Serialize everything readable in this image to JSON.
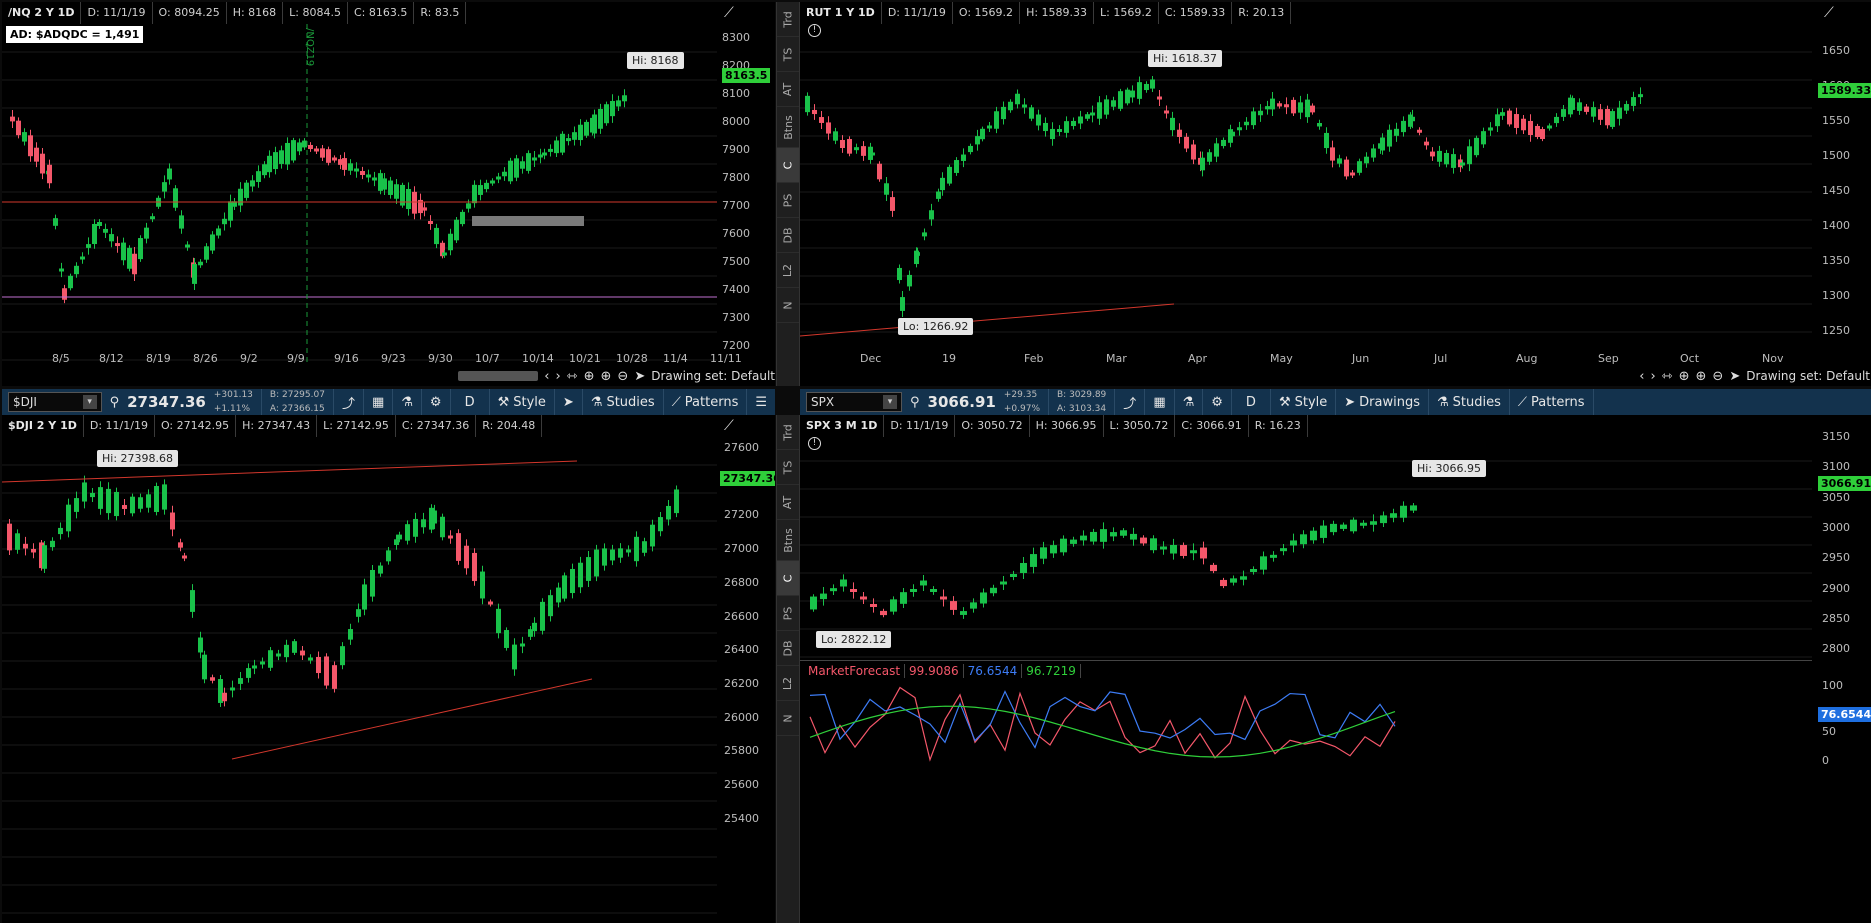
{
  "colors": {
    "up": "#19c24a",
    "down": "#f4576a",
    "accent": "#13324d",
    "pricetag": "#2fcf3a",
    "line_red": "#d2372c",
    "line_purple": "#c070d0"
  },
  "panels": {
    "nq": {
      "header": [
        "/NQ 2 Y 1D",
        "D: 11/1/19",
        "O: 8094.25",
        "H: 8168",
        "L: 8084.5",
        "C: 8163.5",
        "R: 83.5"
      ],
      "ad_label": "AD: $ADQDC = 1,491",
      "price_tag": "8163.5",
      "hi_label": "Hi: 8168",
      "vline_label": "/NQZ19",
      "y_ticks": [
        "8300",
        "8200",
        "8100",
        "8000",
        "7900",
        "7800",
        "7700",
        "7600",
        "7500",
        "7400",
        "7300",
        "7200"
      ],
      "x_ticks": [
        "8/5",
        "8/12",
        "8/19",
        "8/26",
        "9/2",
        "9/9",
        "9/16",
        "9/23",
        "9/30",
        "10/7",
        "10/14",
        "10/21",
        "10/28",
        "11/4",
        "11/11"
      ],
      "drawing_set": "Drawing set: Default",
      "sidebar": [
        "Trd",
        "TS",
        "AT",
        "Btns",
        "C",
        "PS",
        "DB",
        "L2",
        "N"
      ]
    },
    "rut": {
      "header": [
        "RUT 1 Y 1D",
        "D: 11/1/19",
        "O: 1569.2",
        "H: 1589.33",
        "L: 1569.2",
        "C: 1589.33",
        "R: 20.13"
      ],
      "price_tag": "1589.33",
      "hi_label": "Hi: 1618.37",
      "lo_label": "Lo: 1266.92",
      "y_ticks": [
        "1650",
        "1600",
        "1550",
        "1500",
        "1450",
        "1400",
        "1350",
        "1300",
        "1250"
      ],
      "x_ticks": [
        "Dec",
        "19",
        "Feb",
        "Mar",
        "Apr",
        "May",
        "Jun",
        "Jul",
        "Aug",
        "Sep",
        "Oct",
        "Nov"
      ],
      "drawing_set": "Drawing set: Default"
    },
    "dji": {
      "toolbar": {
        "symbol": "$DJI",
        "price": "27347.36",
        "change": "+301.13",
        "change_pct": "+1.11%",
        "bid": "B: 27295.07",
        "ask": "A: 27366.15",
        "period": "D",
        "style": "Style",
        "studies": "Studies",
        "patterns": "Patterns"
      },
      "header": [
        "$DJI 2 Y 1D",
        "D: 11/1/19",
        "O: 27142.95",
        "H: 27347.43",
        "L: 27142.95",
        "C: 27347.36",
        "R: 204.48"
      ],
      "price_tag": "27347.36",
      "hi_label": "Hi: 27398.68",
      "y_ticks": [
        "27600",
        "27400",
        "27200",
        "27000",
        "26800",
        "26600",
        "26400",
        "26200",
        "26000",
        "25800",
        "25600",
        "25400"
      ],
      "sidebar": [
        "Trd",
        "TS",
        "AT",
        "Btns",
        "C",
        "PS",
        "DB",
        "L2",
        "N"
      ]
    },
    "spx": {
      "toolbar": {
        "symbol": "SPX",
        "price": "3066.91",
        "change": "+29.35",
        "change_pct": "+0.97%",
        "bid": "B: 3029.89",
        "ask": "A: 3103.34",
        "period": "D",
        "style": "Style",
        "drawings": "Drawings",
        "studies": "Studies",
        "patterns": "Patterns"
      },
      "header": [
        "SPX 3 M 1D",
        "D: 11/1/19",
        "O: 3050.72",
        "H: 3066.95",
        "L: 3050.72",
        "C: 3066.91",
        "R: 16.23"
      ],
      "price_tag": "3066.91",
      "hi_label": "Hi: 3066.95",
      "lo_label": "Lo: 2822.12",
      "y_ticks": [
        "3150",
        "3100",
        "3050",
        "3000",
        "2950",
        "2900",
        "2850",
        "2800"
      ],
      "study": {
        "name": "MarketForecast",
        "v1": "99.9086",
        "v2": "76.6544",
        "v3": "96.7219",
        "tag": "76.6544",
        "y_ticks": [
          "100",
          "50",
          "0"
        ]
      }
    }
  }
}
